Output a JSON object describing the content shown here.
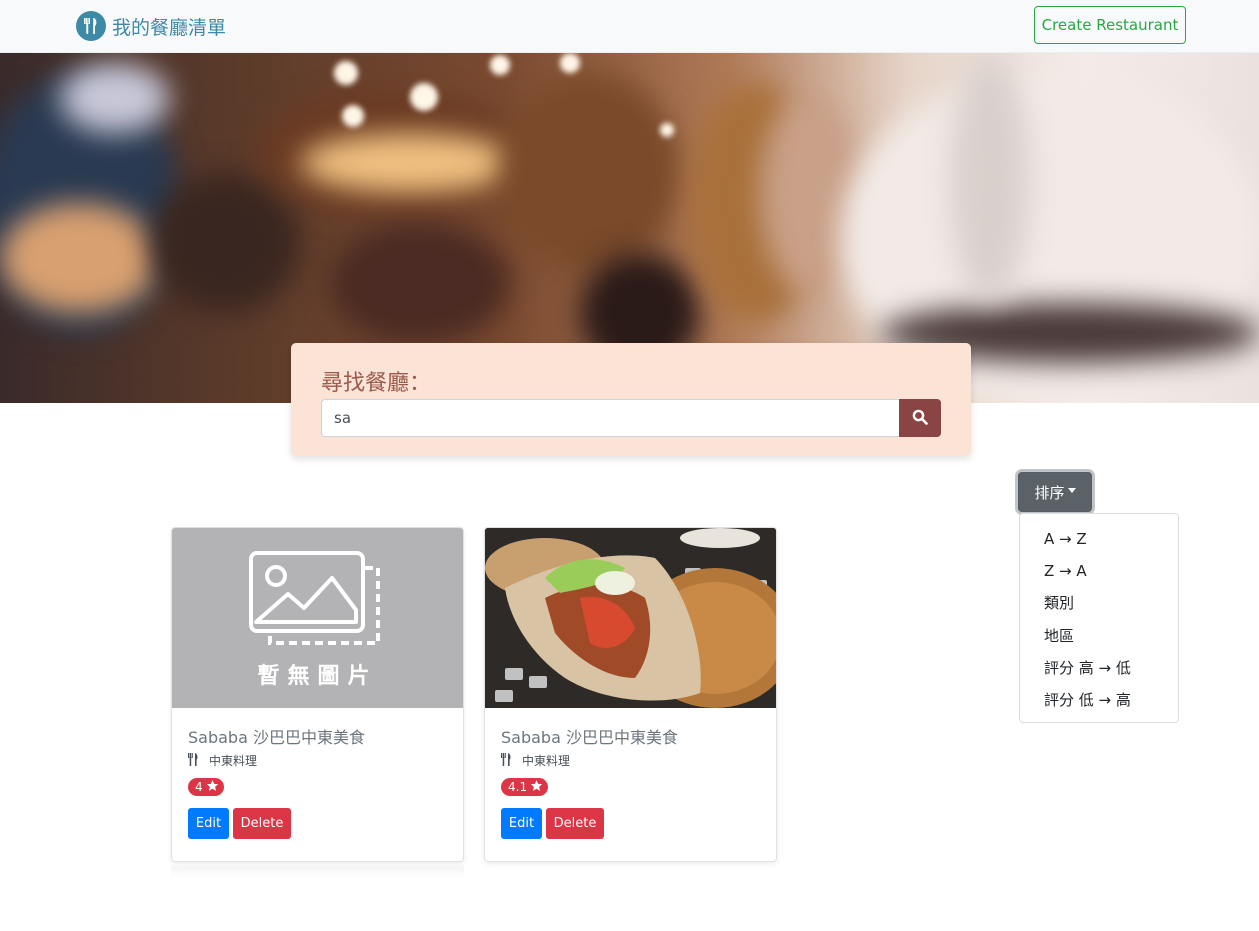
{
  "navbar": {
    "brand_text": "我的餐廳清單",
    "create_button_label": "Create Restaurant"
  },
  "search": {
    "label": "尋找餐廳：",
    "value": "sa"
  },
  "sort": {
    "button_label": "排序",
    "options": [
      "A → Z",
      "Z → A",
      "類別",
      "地區",
      "評分 高 → 低",
      "評分 低 → 高"
    ]
  },
  "restaurants": [
    {
      "name": "Sababa 沙巴巴中東美食",
      "category": "中東料理",
      "rating": "4",
      "image_placeholder_text": "暫無圖片",
      "edit_label": "Edit",
      "delete_label": "Delete"
    },
    {
      "name": "Sababa 沙巴巴中東美食",
      "category": "中東料理",
      "rating": "4.1",
      "edit_label": "Edit",
      "delete_label": "Delete"
    }
  ],
  "colors": {
    "brand": "#3d8aa6",
    "create_button": "#28a745",
    "search_panel": "#fbe3d6",
    "search_button": "#8b4444",
    "rating_badge": "#dc3545",
    "edit_button": "#007bff",
    "delete_button": "#dc3545"
  }
}
